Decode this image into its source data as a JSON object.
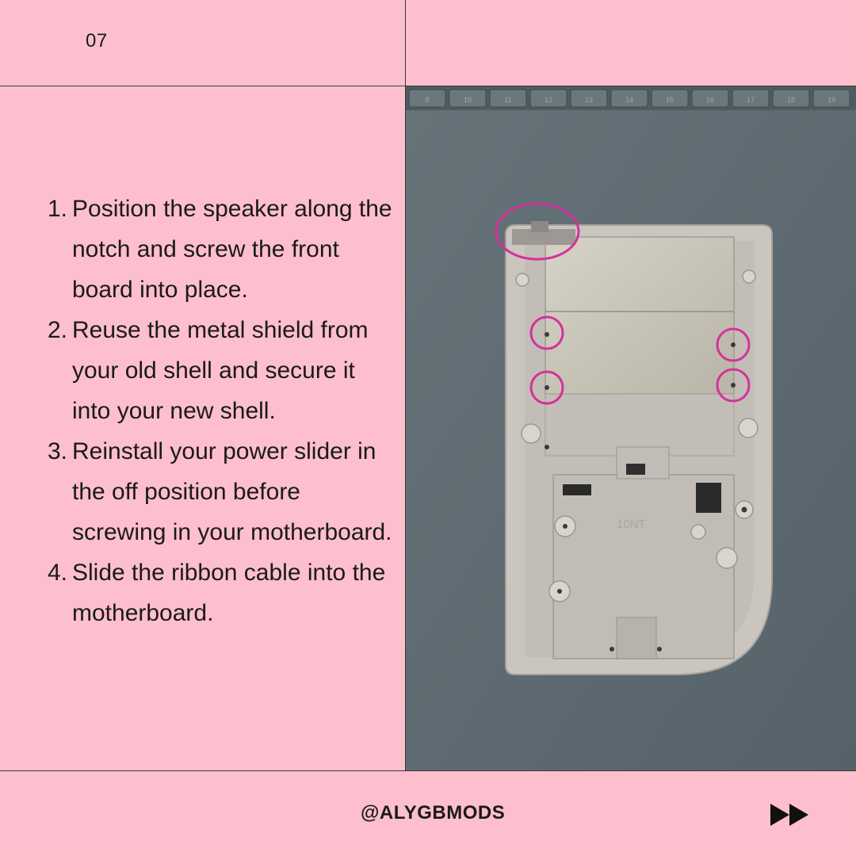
{
  "slide": {
    "number": "07"
  },
  "steps": [
    {
      "num": "1.",
      "text": "Position the speaker along the notch and screw the front board into place."
    },
    {
      "num": "2.",
      "text": "Reuse the metal shield from your old shell and secure it into your new shell."
    },
    {
      "num": "3.",
      "text": "Reinstall your power slider in the off position before screwing in your motherboard."
    },
    {
      "num": "4.",
      "text": "Slide the ribbon cable into the motherboard."
    }
  ],
  "photo": {
    "ruler_labels": [
      "8",
      "10",
      "11",
      "12",
      "13",
      "14",
      "15",
      "16",
      "17",
      "18",
      "19"
    ],
    "shell_emboss": "10NT"
  },
  "footer": {
    "handle": "@ALYGBMODS",
    "next_icon": "fast-forward-icon"
  },
  "colors": {
    "background": "#fdbfce",
    "highlight": "#d6319a",
    "mat": "#5f6c6f",
    "shell": "#c9c3bd"
  }
}
